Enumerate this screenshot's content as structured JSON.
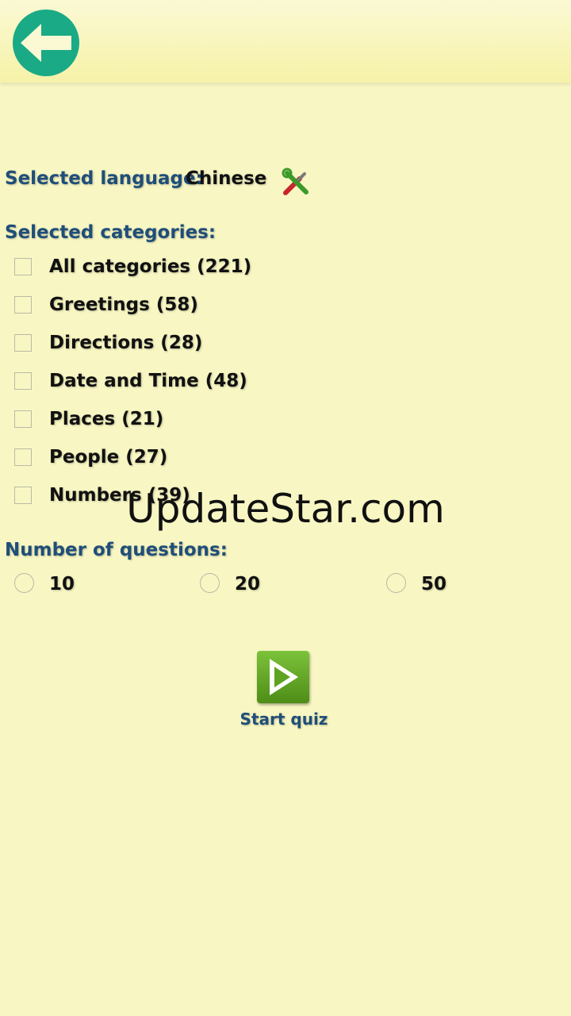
{
  "header": {
    "back_icon": "back-arrow-icon",
    "accent_color": "#1aaa86"
  },
  "language": {
    "label": "Selected language:",
    "value": "Chinese",
    "settings_icon": "tools-icon"
  },
  "categories": {
    "label": "Selected categories:",
    "items": [
      {
        "label": "All categories (221)",
        "checked": false
      },
      {
        "label": "Greetings (58)",
        "checked": false
      },
      {
        "label": "Directions (28)",
        "checked": false
      },
      {
        "label": "Date and Time (48)",
        "checked": false
      },
      {
        "label": "Places (21)",
        "checked": false
      },
      {
        "label": "People (27)",
        "checked": false
      },
      {
        "label": "Numbers (39)",
        "checked": false
      }
    ]
  },
  "questions": {
    "label": "Number of questions:",
    "options": [
      {
        "label": "10",
        "selected": false
      },
      {
        "label": "20",
        "selected": false
      },
      {
        "label": "50",
        "selected": false
      }
    ]
  },
  "start": {
    "label": "Start quiz",
    "icon": "play-icon"
  },
  "watermark": "UpdateStar.com",
  "colors": {
    "background": "#f8f7c3",
    "label_blue": "#1f4e79",
    "play_green": "#5fa322"
  }
}
